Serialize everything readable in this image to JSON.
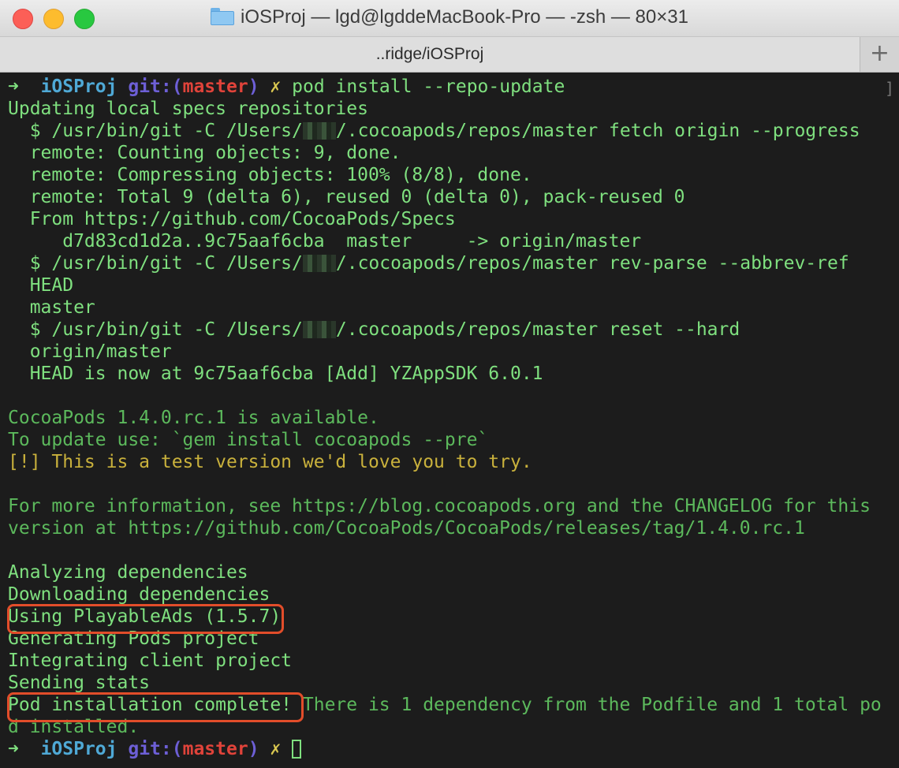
{
  "window": {
    "title_folder": "iOSProj",
    "title_rest": "— lgd@lgddeMacBook-Pro — -zsh — 80×31",
    "tab_label": "..ridge/iOSProj",
    "new_tab_symbol": "+"
  },
  "prompt": {
    "arrow": "➜",
    "project": "iOSProj",
    "git_label": "git:",
    "open_paren": "(",
    "branch": "master",
    "close_paren": ")",
    "dirty_mark": "✗"
  },
  "terminal": {
    "command": "pod install --repo-update",
    "scroll_mark": "]",
    "lines": [
      "Updating local specs repositories",
      "  $ /usr/bin/git -C /Users/",
      "/.cocoapods/repos/master fetch origin --progress",
      "  remote: Counting objects: 9, done.",
      "  remote: Compressing objects: 100% (8/8), done.",
      "  remote: Total 9 (delta 6), reused 0 (delta 0), pack-reused 0",
      "  From https://github.com/CocoaPods/Specs",
      "     d7d83cd1d2a..9c75aaf6cba  master     -> origin/master",
      "  $ /usr/bin/git -C /Users/",
      "/.cocoapods/repos/master rev-parse --abbrev-ref",
      "  HEAD",
      "  master",
      "  $ /usr/bin/git -C /Users/",
      "/.cocoapods/repos/master reset --hard",
      "  origin/master",
      "  HEAD is now at 9c75aaf6cba [Add] YZAppSDK 6.0.1",
      "CocoaPods 1.4.0.rc.1 is available.",
      "To update use: `gem install cocoapods --pre`",
      "[!] This is a test version we'd love you to try.",
      "For more information, see https://blog.cocoapods.org and the CHANGELOG for this",
      "version at https://github.com/CocoaPods/CocoaPods/releases/tag/1.4.0.rc.1",
      "Analyzing dependencies",
      "Downloading dependencies",
      "Using PlayableAds (1.5.7)",
      "Generating Pods project",
      "Integrating client project",
      "Sending stats",
      "Pod installation complete!",
      " There is 1 dependency from the Podfile and 1 total po",
      "d installed."
    ]
  },
  "colors": {
    "background": "#1c1c1c",
    "text_green": "#7fe07f",
    "highlight_box": "#e24d2a"
  }
}
